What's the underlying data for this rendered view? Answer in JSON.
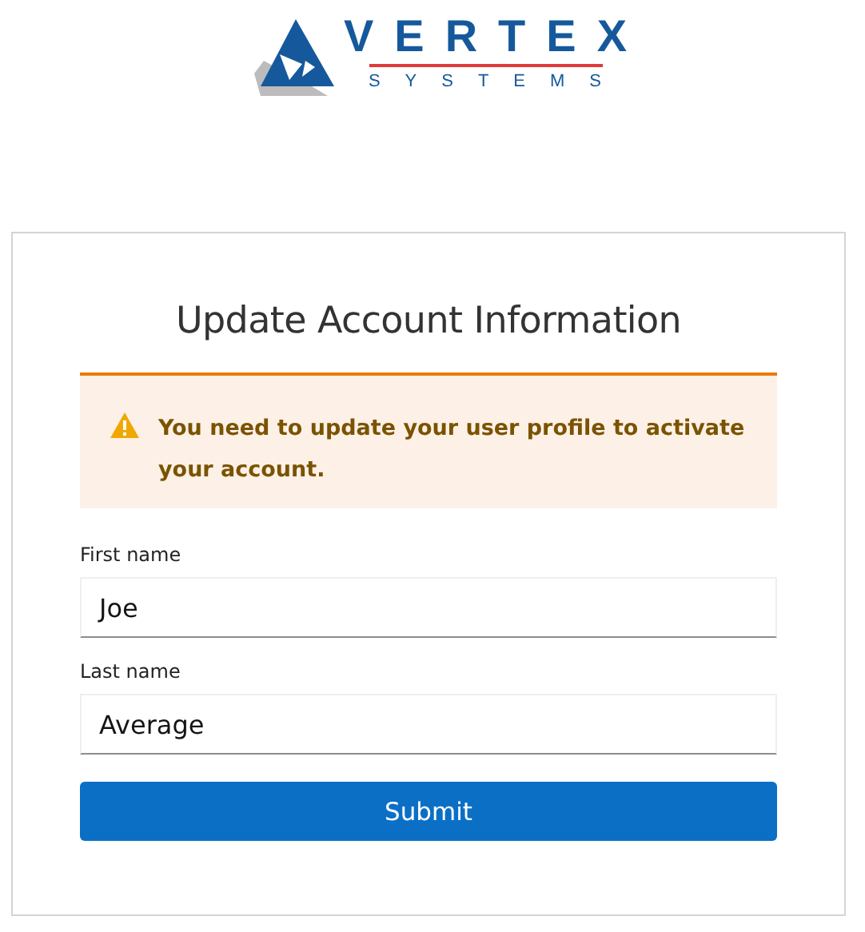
{
  "logo": {
    "name": "VERTEX",
    "tagline": "SYSTEMS"
  },
  "title": "Update Account Information",
  "alert": {
    "kind": "warning",
    "message": "You need to update your user profile to activate your account."
  },
  "fields": [
    {
      "label": "First name",
      "value": "Joe"
    },
    {
      "label": "Last name",
      "value": "Average"
    }
  ],
  "submit": "Submit"
}
